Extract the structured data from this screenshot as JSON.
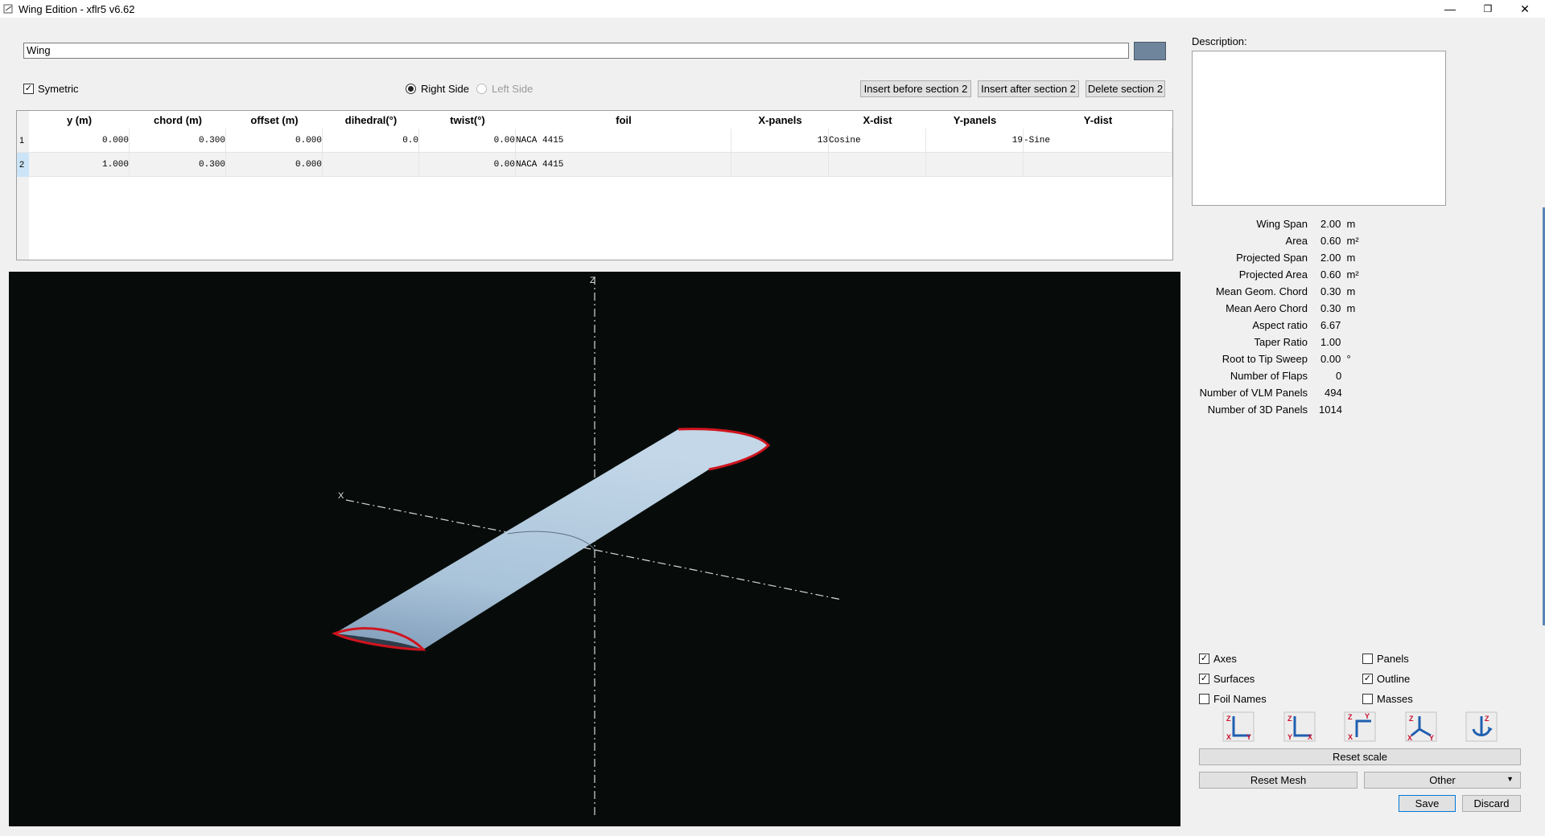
{
  "window": {
    "title": "Wing Edition - xflr5 v6.62",
    "controls": {
      "minimize": "—",
      "restore": "❐",
      "close": "✕"
    }
  },
  "wing_name": "Wing",
  "wing_color": "#6f859c",
  "options": {
    "symetric_label": "Symetric",
    "symetric_checked": true,
    "right_side_label": "Right Side",
    "left_side_label": "Left Side",
    "selected_side": "Right Side"
  },
  "section_buttons": {
    "insert_before": "Insert before section 2",
    "insert_after": "Insert after section 2",
    "delete": "Delete section 2"
  },
  "table": {
    "columns": [
      "y (m)",
      "chord (m)",
      "offset (m)",
      "dihedral(°)",
      "twist(°)",
      "foil",
      "X-panels",
      "X-dist",
      "Y-panels",
      "Y-dist"
    ],
    "rows": [
      {
        "index": "1",
        "y": "0.000",
        "chord": "0.300",
        "offset": "0.000",
        "dihedral": "0.0",
        "twist": "0.00",
        "foil": "NACA 4415",
        "x_panels": "13",
        "x_dist": "Cosine",
        "y_panels": "19",
        "y_dist": "-Sine"
      },
      {
        "index": "2",
        "y": "1.000",
        "chord": "0.300",
        "offset": "0.000",
        "dihedral": "",
        "twist": "0.00",
        "foil": "NACA 4415",
        "x_panels": "",
        "x_dist": "",
        "y_panels": "",
        "y_dist": ""
      }
    ]
  },
  "view3d": {
    "axis_x_label": "X",
    "axis_z_label": "Z",
    "wing_color": "#a9c3d9",
    "outline_color": "#d0141e"
  },
  "description": {
    "label": "Description:",
    "text": ""
  },
  "properties": [
    {
      "name": "Wing Span",
      "value": "2.00",
      "unit": "m"
    },
    {
      "name": "Area",
      "value": "0.60",
      "unit": "m²"
    },
    {
      "name": "Projected Span",
      "value": "2.00",
      "unit": "m"
    },
    {
      "name": "Projected Area",
      "value": "0.60",
      "unit": "m²"
    },
    {
      "name": "Mean Geom. Chord",
      "value": "0.30",
      "unit": "m"
    },
    {
      "name": "Mean Aero Chord",
      "value": "0.30",
      "unit": "m"
    },
    {
      "name": "Aspect ratio",
      "value": "6.67",
      "unit": ""
    },
    {
      "name": "Taper Ratio",
      "value": "1.00",
      "unit": ""
    },
    {
      "name": "Root to Tip Sweep",
      "value": "0.00",
      "unit": "°"
    },
    {
      "name": "Number of Flaps",
      "value": "0",
      "unit": ""
    },
    {
      "name": "Number of VLM Panels",
      "value": "494",
      "unit": ""
    },
    {
      "name": "Number of 3D Panels",
      "value": "1014",
      "unit": ""
    }
  ],
  "display_checks": [
    {
      "label": "Axes",
      "checked": true
    },
    {
      "label": "Panels",
      "checked": false
    },
    {
      "label": "Surfaces",
      "checked": true
    },
    {
      "label": "Outline",
      "checked": true
    },
    {
      "label": "Foil Names",
      "checked": false
    },
    {
      "label": "Masses",
      "checked": false
    }
  ],
  "view_buttons": [
    "front-view-icon",
    "side-view-icon",
    "top-view-icon",
    "iso-view-icon",
    "flip-view-icon"
  ],
  "buttons": {
    "reset_scale": "Reset scale",
    "reset_mesh": "Reset Mesh",
    "other": "Other",
    "save": "Save",
    "discard": "Discard"
  }
}
